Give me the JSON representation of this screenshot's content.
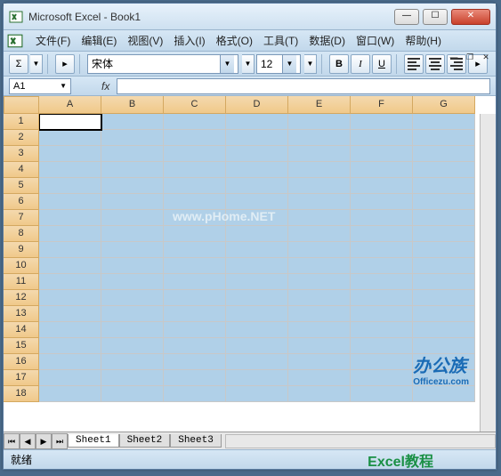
{
  "title": "Microsoft Excel - Book1",
  "menu": [
    "文件(F)",
    "编辑(E)",
    "视图(V)",
    "插入(I)",
    "格式(O)",
    "工具(T)",
    "数据(D)",
    "窗口(W)",
    "帮助(H)"
  ],
  "toolbar": {
    "sigma": "Σ",
    "font_name": "宋体",
    "font_size": "12",
    "bold": "B",
    "italic": "I",
    "underline": "U"
  },
  "namebox_value": "A1",
  "fx_label": "fx",
  "columns": [
    "A",
    "B",
    "C",
    "D",
    "E",
    "F",
    "G"
  ],
  "rows": [
    "1",
    "2",
    "3",
    "4",
    "5",
    "6",
    "7",
    "8",
    "9",
    "10",
    "11",
    "12",
    "13",
    "14",
    "15",
    "16",
    "17",
    "18"
  ],
  "active_cell": {
    "row": 0,
    "col": 0
  },
  "sheets": [
    "Sheet1",
    "Sheet2",
    "Sheet3"
  ],
  "active_sheet": 0,
  "status": "就绪",
  "watermark": "www.pHome.NET",
  "logo": {
    "main": "办公族",
    "sub": "Officezu.com"
  },
  "tutorial_text": "Excel教程"
}
